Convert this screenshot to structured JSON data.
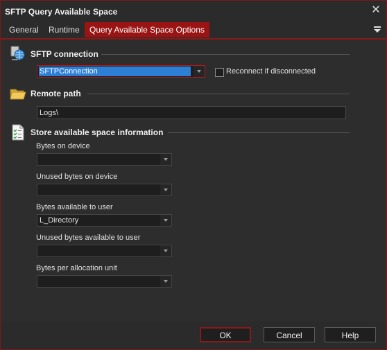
{
  "window": {
    "title": "SFTP Query Available Space",
    "close_glyph": "✕"
  },
  "tabs": [
    {
      "label": "General"
    },
    {
      "label": "Runtime"
    },
    {
      "label": "Query Available Space Options",
      "active": true
    }
  ],
  "sections": {
    "sftp_connection": {
      "title": "SFTP connection",
      "icon": "network-globe-icon",
      "connection_value": "SFTPConnection",
      "reconnect_label": "Reconnect if disconnected",
      "reconnect_checked": false
    },
    "remote_path": {
      "title": "Remote path",
      "icon": "folder-icon",
      "value": "Logs\\"
    },
    "store": {
      "title": "Store available space information",
      "icon": "checklist-document-icon",
      "fields": [
        {
          "label": "Bytes on device",
          "value": ""
        },
        {
          "label": "Unused bytes on device",
          "value": ""
        },
        {
          "label": "Bytes available to user",
          "value": "L_Directory"
        },
        {
          "label": "Unused bytes available to user",
          "value": ""
        },
        {
          "label": "Bytes per allocation unit",
          "value": ""
        }
      ]
    }
  },
  "footer": {
    "ok_label": "OK",
    "cancel_label": "Cancel",
    "help_label": "Help"
  },
  "colors": {
    "accent": "#9a1414",
    "selection": "#2d7fd6",
    "background": "#2d2d2d"
  }
}
